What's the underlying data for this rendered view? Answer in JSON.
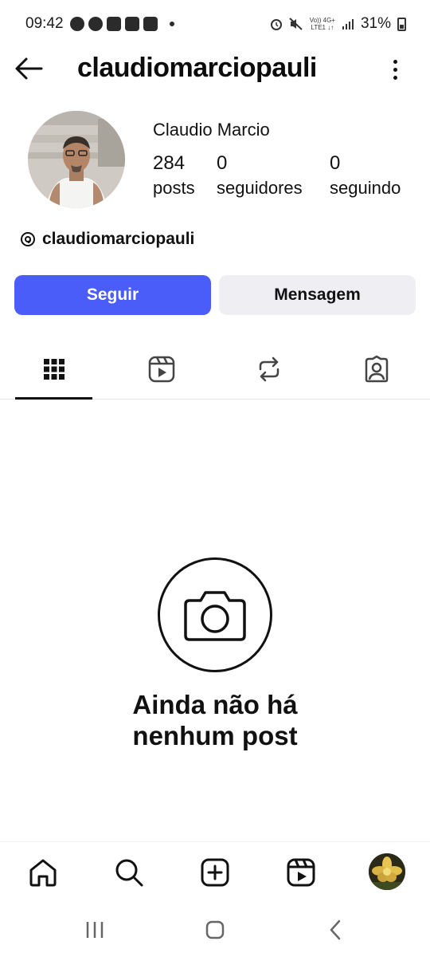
{
  "status_bar": {
    "time": "09:42",
    "network_top": "Vo)) 4G+",
    "network_bottom": "LTE1 ↓↑",
    "battery": "31%"
  },
  "header": {
    "username": "claudiomarciopauli"
  },
  "profile": {
    "display_name": "Claudio Marcio",
    "stats": {
      "posts_count": "284",
      "posts_label": "posts",
      "followers_count": "0",
      "followers_label": "seguidores",
      "following_count": "0",
      "following_label": "seguindo"
    },
    "threads_handle": "claudiomarciopauli"
  },
  "actions": {
    "follow_label": "Seguir",
    "message_label": "Mensagem"
  },
  "tabs": [
    {
      "icon": "grid-icon",
      "active": true
    },
    {
      "icon": "reels-icon",
      "active": false
    },
    {
      "icon": "repost-icon",
      "active": false
    },
    {
      "icon": "tagged-icon",
      "active": false
    }
  ],
  "empty_state": {
    "line1": "Ainda não há",
    "line2": "nenhum post"
  },
  "bottom_nav": [
    "home-icon",
    "search-icon",
    "create-icon",
    "reels-icon",
    "profile-avatar"
  ],
  "colors": {
    "accent": "#4a5df9",
    "secondary_button": "#efeff3",
    "text": "#0c0c0c"
  }
}
